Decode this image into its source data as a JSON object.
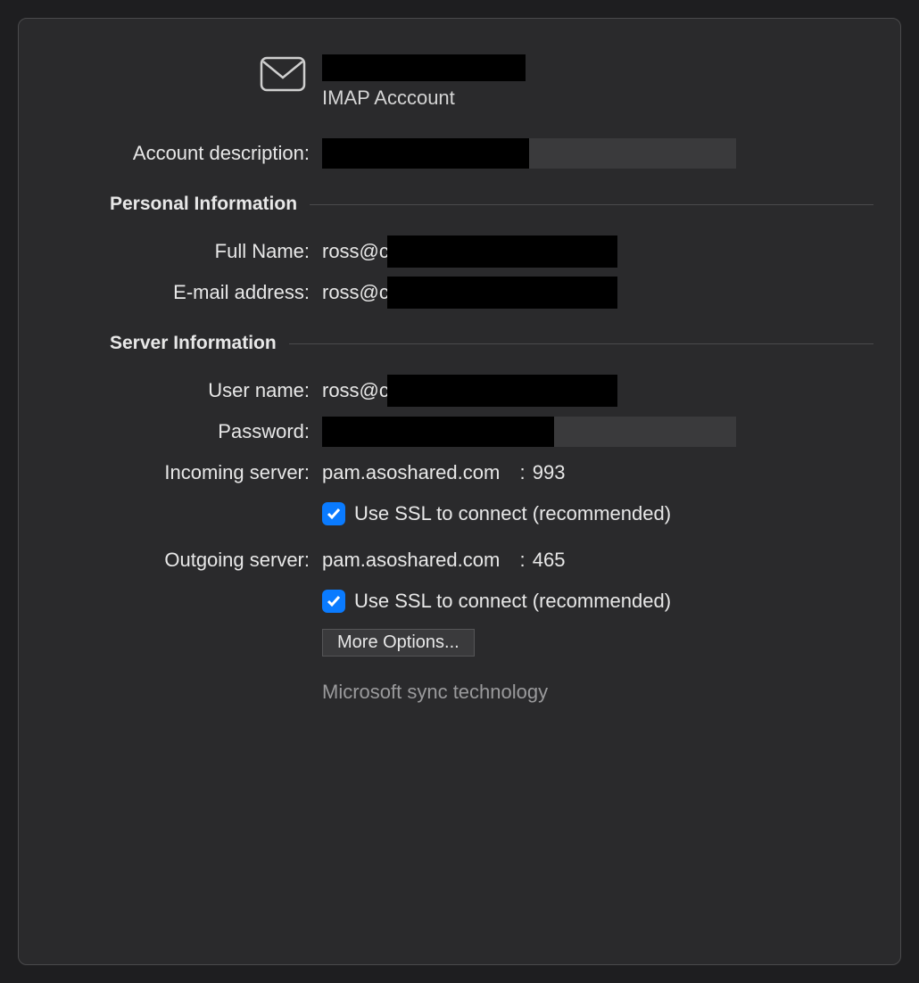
{
  "header": {
    "account_type": "IMAP Acccount"
  },
  "labels": {
    "account_description": "Account description:",
    "full_name": "Full Name:",
    "email_address": "E-mail address:",
    "user_name": "User name:",
    "password": "Password:",
    "incoming_server": "Incoming server:",
    "outgoing_server": "Outgoing server:"
  },
  "sections": {
    "personal_info": "Personal Information",
    "server_info": "Server Information"
  },
  "values": {
    "full_name_prefix": "ross@c",
    "email_prefix": "ross@c",
    "user_name_prefix": "ross@c",
    "incoming_server_host": "pam.asoshared.com",
    "incoming_server_port_sep": "  : ",
    "incoming_server_port": "993",
    "outgoing_server_host": "pam.asoshared.com",
    "outgoing_server_port_sep": "  : ",
    "outgoing_server_port": "465"
  },
  "checkboxes": {
    "incoming_ssl_label": "Use SSL to connect (recommended)",
    "incoming_ssl_checked": true,
    "outgoing_ssl_label": "Use SSL to connect (recommended)",
    "outgoing_ssl_checked": true
  },
  "buttons": {
    "more_options": "More Options..."
  },
  "footer": {
    "sync_tech": "Microsoft sync technology"
  }
}
